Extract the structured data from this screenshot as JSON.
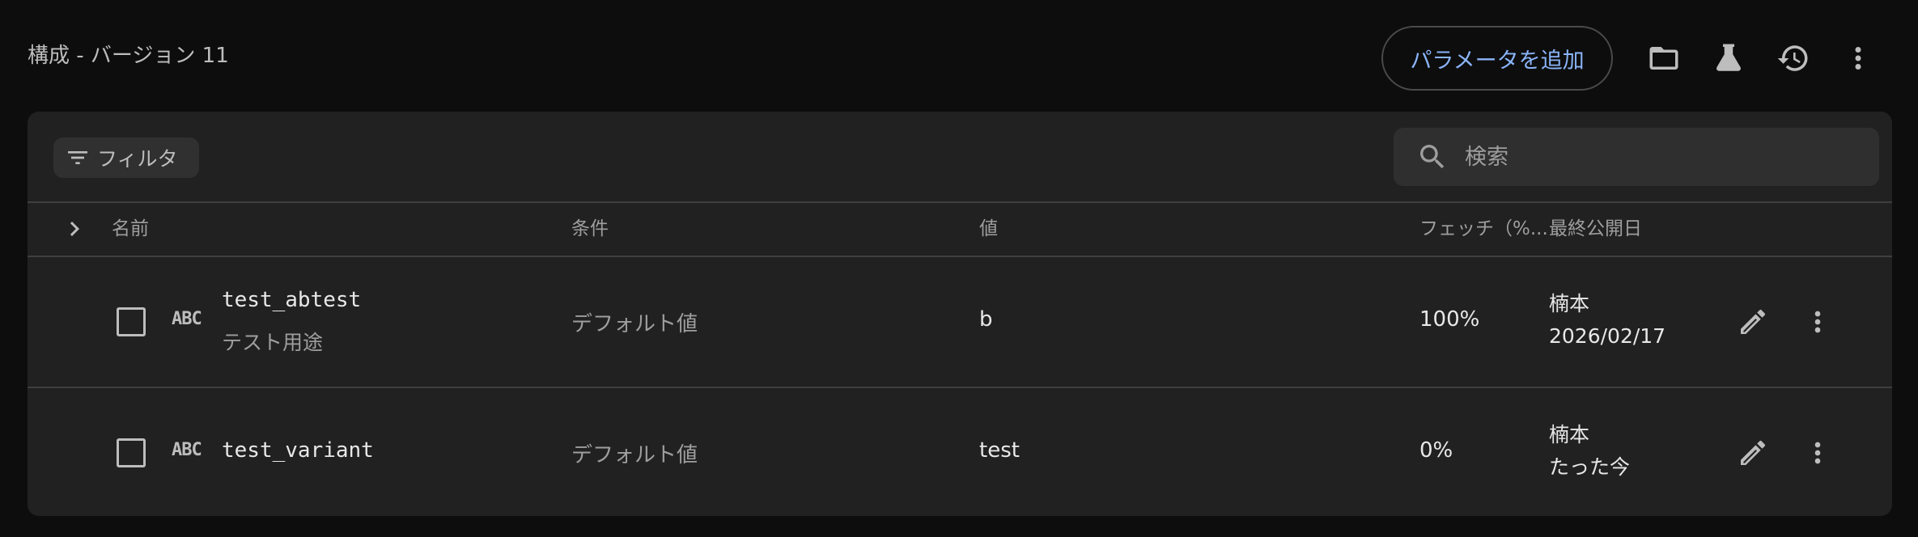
{
  "header": {
    "title": "構成 - バージョン 11",
    "add_param_label": "パラメータを追加",
    "icons": [
      "folder-icon",
      "flask-icon",
      "history-icon",
      "more-vert-icon"
    ]
  },
  "toolbar": {
    "filter_label": "フィルタ",
    "search_placeholder": "検索"
  },
  "table": {
    "columns": {
      "name": "名前",
      "condition": "条件",
      "value": "値",
      "fetch": "フェッチ（%...",
      "published": "最終公開日"
    },
    "rows": [
      {
        "key": "test_abtest",
        "type_icon": "ABC",
        "description": "テスト用途",
        "condition": "デフォルト値",
        "value": "b",
        "fetch": "100%",
        "publisher": "楠本",
        "published": "2026/02/17"
      },
      {
        "key": "test_variant",
        "type_icon": "ABC",
        "description": "",
        "condition": "デフォルト値",
        "value": "test",
        "fetch": "0%",
        "publisher": "楠本",
        "published": "たった今"
      }
    ]
  }
}
